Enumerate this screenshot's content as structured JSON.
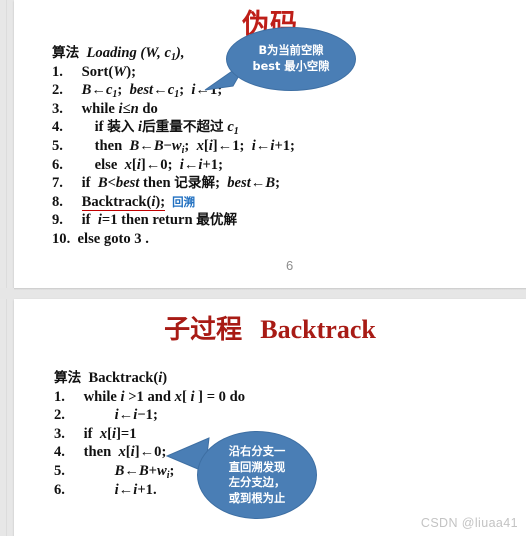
{
  "document": {
    "watermark": "CSDN @liuaa41"
  },
  "colors": {
    "title_red": "#BE1E18",
    "bubble_blue": "#4A7EB5",
    "annotation_blue": "#1F6FC0",
    "underline_red": "#C00000",
    "page_gray": "#8d8d8d",
    "watermark_gray": "#c3c3c3"
  },
  "slide1": {
    "title": "伪码",
    "page_number": "6",
    "algorithm_header_cjk": "算法",
    "algorithm_header_name": "Loading (W, c1),",
    "lines": [
      {
        "num": "1.",
        "text": "Sort(W);"
      },
      {
        "num": "2.",
        "text": "B←c1;  best←c1;  i←1;"
      },
      {
        "num": "3.",
        "text": "while i≤n do"
      },
      {
        "num": "4.",
        "text": "if 装入 i后重量不超过 c1"
      },
      {
        "num": "5.",
        "text": "then  B←B−wi;  x[i]←1;  i←i+1;"
      },
      {
        "num": "6.",
        "text": "else  x[i]←0;  i←i+1;"
      },
      {
        "num": "7.",
        "text": "if  B<best then 记录解;  best←B;"
      },
      {
        "num": "8.",
        "text": "Backtrack(i);",
        "annotation": "回溯"
      },
      {
        "num": "9.",
        "text": "if  i=1 then return 最优解"
      },
      {
        "num": "10.",
        "text": "else goto 3 ."
      }
    ],
    "callout": {
      "line1": "B为当前空隙",
      "line2": "best 最小空隙"
    }
  },
  "slide2": {
    "title_cjk": "子过程",
    "title_en": "Backtrack",
    "algorithm_header_cjk": "算法",
    "algorithm_header_name": "Backtrack(i)",
    "lines": [
      {
        "num": "1.",
        "text": "while i >1 and x[ i ] = 0 do"
      },
      {
        "num": "2.",
        "text": "i←i−1;"
      },
      {
        "num": "3.",
        "text": "if  x[i]=1"
      },
      {
        "num": "4.",
        "text": "then  x[i]←0;"
      },
      {
        "num": "5.",
        "text": "B←B+wi;"
      },
      {
        "num": "6.",
        "text": "i←i+1."
      }
    ],
    "callout": {
      "line1": "沿右分支一",
      "line2": "直回溯发现",
      "line3": "左分支边，",
      "line4": "或到根为止"
    }
  }
}
